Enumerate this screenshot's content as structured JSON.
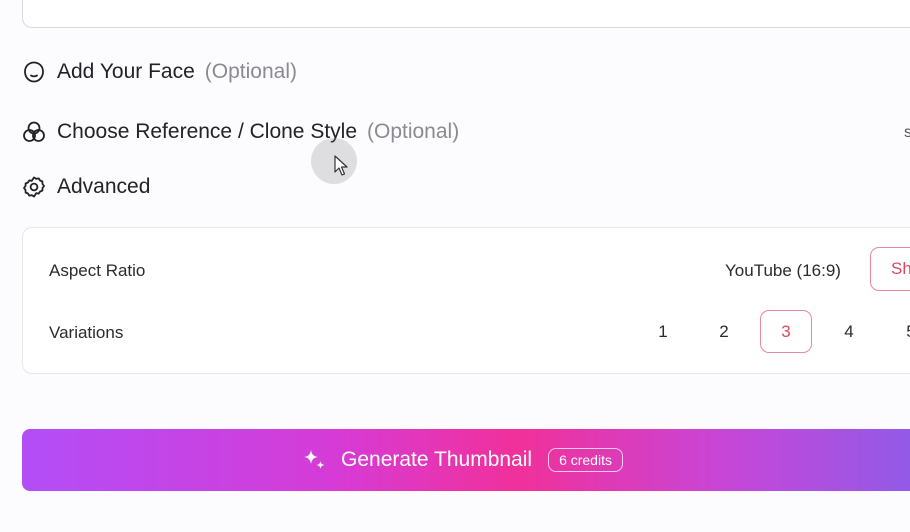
{
  "sections": {
    "face": {
      "label": "Add Your Face",
      "optional": "(Optional)",
      "icon": "face-icon"
    },
    "reference": {
      "label": "Choose Reference / Clone Style",
      "optional": "(Optional)",
      "icon": "overlapping-circles-icon"
    },
    "advanced": {
      "label": "Advanced",
      "icon": "gear-icon"
    }
  },
  "advanced_panel": {
    "aspect_ratio": {
      "label": "Aspect Ratio",
      "value": "YouTube (16:9)",
      "button_label": "Sh"
    },
    "variations": {
      "label": "Variations",
      "options": [
        "1",
        "2",
        "3",
        "4",
        "5"
      ],
      "selected": "3"
    }
  },
  "generate": {
    "label": "Generate Thumbnail",
    "credits": "6 credits",
    "icon": "sparkle-icon"
  },
  "edge_chars": {
    "row_ref": "s"
  },
  "colors": {
    "accent": "#d44a62",
    "gradient_start": "#b24ef7",
    "gradient_mid": "#f1309a",
    "gradient_end": "#8f5be8"
  }
}
